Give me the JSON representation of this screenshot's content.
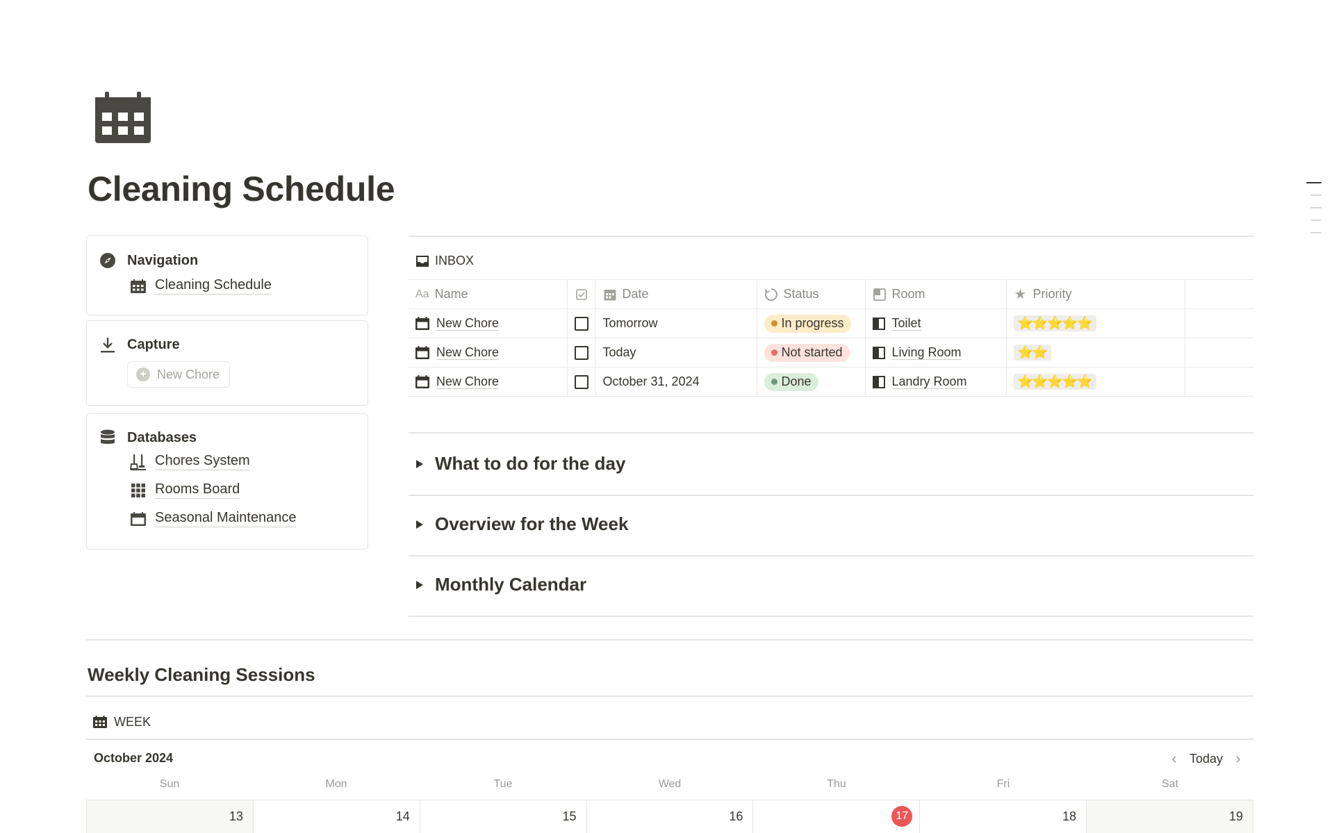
{
  "page": {
    "icon": "calendar-icon",
    "title": "Cleaning Schedule"
  },
  "navigation": {
    "heading": "Navigation",
    "links": [
      {
        "label": "Cleaning Schedule",
        "icon": "calendar-icon"
      }
    ]
  },
  "capture": {
    "heading": "Capture",
    "button_label": "New Chore"
  },
  "databases": {
    "heading": "Databases",
    "links": [
      {
        "label": "Chores System",
        "icon": "broom-icon"
      },
      {
        "label": "Rooms Board",
        "icon": "grid-icon"
      },
      {
        "label": "Seasonal Maintenance",
        "icon": "calendar-icon"
      }
    ]
  },
  "inbox": {
    "view_label": "INBOX",
    "columns": [
      "Name",
      "",
      "Date",
      "Status",
      "Room",
      "Priority"
    ],
    "name_prefix": "Aa",
    "rows": [
      {
        "name": "New Chore",
        "done": false,
        "date": "Tomorrow",
        "status": "In progress",
        "room": "Toilet",
        "priority": "⭐⭐⭐⭐⭐"
      },
      {
        "name": "New Chore",
        "done": false,
        "date": "Today",
        "status": "Not started",
        "room": "Living Room",
        "priority": "⭐⭐"
      },
      {
        "name": "New Chore",
        "done": false,
        "date": "October 31, 2024",
        "status": "Done",
        "room": "Landry Room",
        "priority": "⭐⭐⭐⭐⭐"
      }
    ],
    "status_colors": {
      "In progress": {
        "bg": "#fdecc8",
        "dot": "#cb912f"
      },
      "Not started": {
        "bg": "#ffe2dd",
        "dot": "#e16f64"
      },
      "Done": {
        "bg": "#dbeddb",
        "dot": "#6c9b7d"
      }
    }
  },
  "toggles": [
    {
      "title": "What to do for the day"
    },
    {
      "title": "Overview for the Week"
    },
    {
      "title": "Monthly Calendar"
    }
  ],
  "weekly": {
    "section_title": "Weekly Cleaning Sessions",
    "view_label": "WEEK",
    "month": "October 2024",
    "today_label": "Today",
    "day_names": [
      "Sun",
      "Mon",
      "Tue",
      "Wed",
      "Thu",
      "Fri",
      "Sat"
    ],
    "dates": [
      "13",
      "14",
      "15",
      "16",
      "17",
      "18",
      "19"
    ],
    "today_index": 4,
    "today_color": "#eb5757"
  }
}
